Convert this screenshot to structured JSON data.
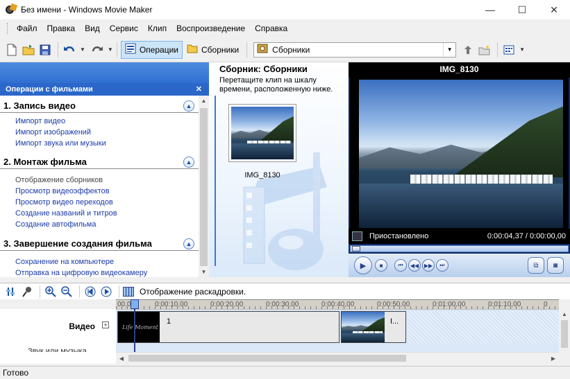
{
  "window": {
    "title": "Без имени - Windows Movie Maker",
    "minimize_glyph": "—",
    "maximize_glyph": "☐",
    "close_glyph": "✕"
  },
  "menu": [
    "Файл",
    "Правка",
    "Вид",
    "Сервис",
    "Клип",
    "Воспроизведение",
    "Справка"
  ],
  "toolbar": {
    "tasks_label": "Операции",
    "collections_label": "Сборники",
    "collection_select_value": "Сборники"
  },
  "tasks": {
    "header": "Операции с фильмами",
    "close_glyph": "✕",
    "sections": [
      {
        "title": "1. Запись видео",
        "links": [
          "Импорт видео",
          "Импорт изображений",
          "Импорт звука или музыки"
        ]
      },
      {
        "title": "2. Монтаж фильма",
        "links": [
          "Отображение сборников",
          "Просмотр видеоэффектов",
          "Просмотр видео переходов",
          "Создание названий и титров",
          "Создание автофильма"
        ]
      },
      {
        "title": "3. Завершение создания фильма",
        "links": [
          "Сохранение на компьютере",
          "Отправка на цифровую видеокамеру"
        ]
      }
    ]
  },
  "collection": {
    "title": "Сборник: Сборники",
    "hint": "Перетащите клип на шкалу времени, расположенную ниже.",
    "clip_name": "IMG_8130"
  },
  "preview": {
    "title": "IMG_8130",
    "state": "Приостановлено",
    "time": "0:00:04,37 / 0:00:00,00"
  },
  "timeline": {
    "storyboard_label": "Отображение раскадровки.",
    "ruler": [
      "00,00",
      "0:00:10,00",
      "0:00:20,00",
      "0:00:30,00",
      "0:00:40,00",
      "0:00:50,00",
      "0:01:00,00",
      "0:01:10,00",
      "0"
    ],
    "video_label": "Видео",
    "expand_glyph": "+",
    "audio_label": "Звук или музыка",
    "clips": [
      {
        "number": "1",
        "thumb_text": "Life Moment"
      },
      {
        "number": "I..."
      }
    ]
  },
  "status": "Готово",
  "colors": {
    "accent_blue": "#2b67c9",
    "link_blue": "#1a3aa8",
    "preview_bg": "#0d2a66"
  }
}
